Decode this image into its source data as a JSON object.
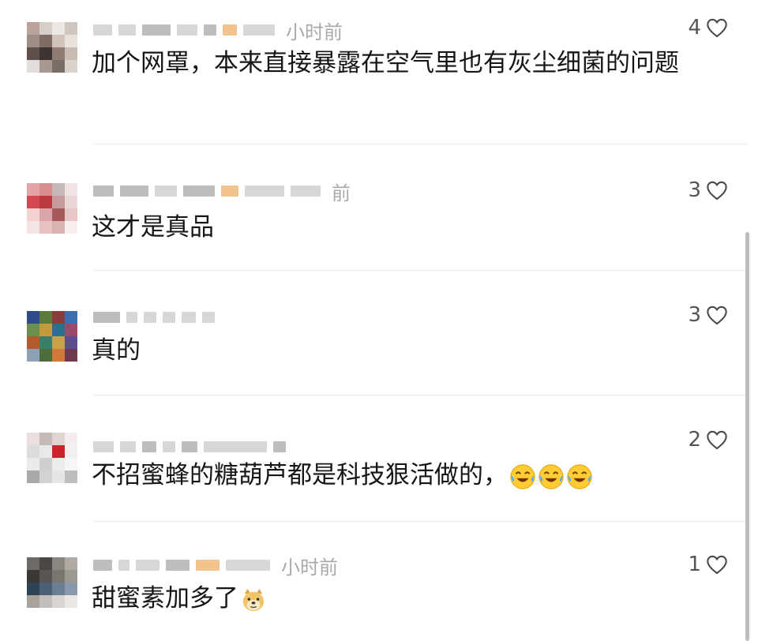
{
  "comments": [
    {
      "time": "小时前",
      "text": "加个网罩，本来直接暴露在空气里也有灰尘细菌的问题",
      "likes": "4",
      "emojis": [],
      "avatar_colors": [
        "#b9a39a",
        "#d6cfc9",
        "#ede7e3",
        "#cfc6bf",
        "#9e8d86",
        "#7d6c64",
        "#d2c3ba",
        "#e8e1dc",
        "#5f504c",
        "#3e3533",
        "#8f7d74",
        "#c7bbb4",
        "#e3dedb",
        "#a79891",
        "#7a6c66",
        "#d9d2cd"
      ]
    },
    {
      "time": "前",
      "text": "这才是真品",
      "likes": "3",
      "emojis": [],
      "avatar_colors": [
        "#e6a3a6",
        "#d88d91",
        "#c9b8b8",
        "#efe3e3",
        "#d24a4f",
        "#b83a3f",
        "#c79a9c",
        "#e9d6d6",
        "#f1d1d2",
        "#d9a5a8",
        "#a65a5d",
        "#e8c6c7",
        "#f4e4e4",
        "#e9c1c3",
        "#d9b2b3",
        "#f7eeee"
      ]
    },
    {
      "time": "",
      "text": "真的",
      "likes": "3",
      "emojis": [],
      "avatar_colors": [
        "#2f4b8a",
        "#5c7a3a",
        "#8a3b3b",
        "#3d6fb0",
        "#6d8f4e",
        "#c39b3c",
        "#2e6e8e",
        "#9a4a6b",
        "#b35a2f",
        "#3a7f6a",
        "#c7a24a",
        "#5d4f8f",
        "#8fa1b6",
        "#4f6d3a",
        "#d07a3a",
        "#6e3a4f"
      ]
    },
    {
      "time": "",
      "text": "不招蜜蜂的糖葫芦都是科技狠活做的，",
      "likes": "2",
      "emojis": [
        "laugh-cry",
        "laugh-cry",
        "laugh-cry"
      ],
      "avatar_colors": [
        "#ecdede",
        "#c8b9b9",
        "#e2d3d3",
        "#f5eded",
        "#dcdcdc",
        "#e9e9e9",
        "#c9232b",
        "#f0f0f0",
        "#eaeaea",
        "#cfcfcf",
        "#ececec",
        "#f6f6f6",
        "#a9a9a9",
        "#d2d2d2",
        "#e6e6e6",
        "#bdbdbd"
      ]
    },
    {
      "time": "小时前",
      "text": "甜蜜素加多了",
      "likes": "1",
      "emojis": [
        "doge"
      ],
      "avatar_colors": [
        "#6e6a66",
        "#4b4745",
        "#8b857f",
        "#b1aaa4",
        "#3b3836",
        "#5a5552",
        "#7b7570",
        "#9e9893",
        "#2f4357",
        "#4b6077",
        "#6a7f94",
        "#8799ab",
        "#a9a29c",
        "#c3beba",
        "#d8d4d1",
        "#e9e6e3"
      ]
    }
  ]
}
